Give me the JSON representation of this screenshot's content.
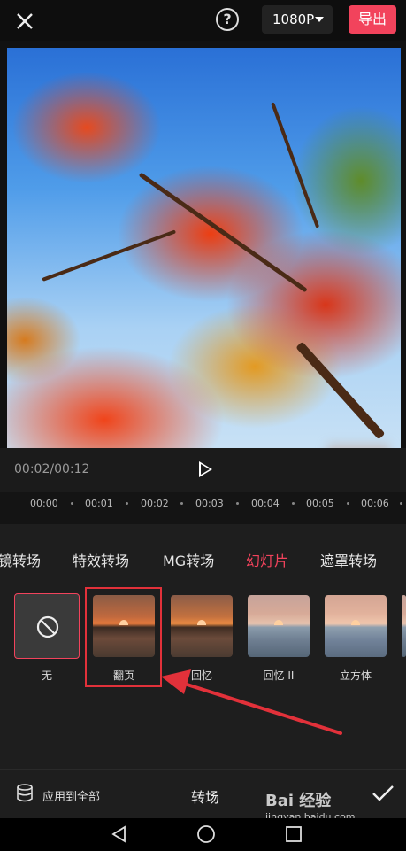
{
  "topbar": {
    "resolution": "1080P",
    "export_label": "导出",
    "help_label": "?"
  },
  "player": {
    "timecode": "00:02/00:12"
  },
  "ruler": {
    "ticks": [
      "00:00",
      "00:01",
      "00:02",
      "00:03",
      "00:04",
      "00:05",
      "00:06"
    ]
  },
  "tabs": {
    "items": [
      "镜转场",
      "特效转场",
      "MG转场",
      "幻灯片",
      "遮罩转场"
    ],
    "active": "幻灯片"
  },
  "transitions": {
    "items": [
      {
        "label": "无"
      },
      {
        "label": "翻页"
      },
      {
        "label": "回忆"
      },
      {
        "label": "回忆 II"
      },
      {
        "label": "立方体"
      }
    ],
    "selected": "无"
  },
  "bottom": {
    "apply_all": "应用到全部",
    "title": "转场"
  },
  "watermark": {
    "text": "Bai 经验",
    "url": "jingyan.baidu.com"
  },
  "colors": {
    "accent": "#f2435c",
    "annotation": "#e2313a"
  }
}
